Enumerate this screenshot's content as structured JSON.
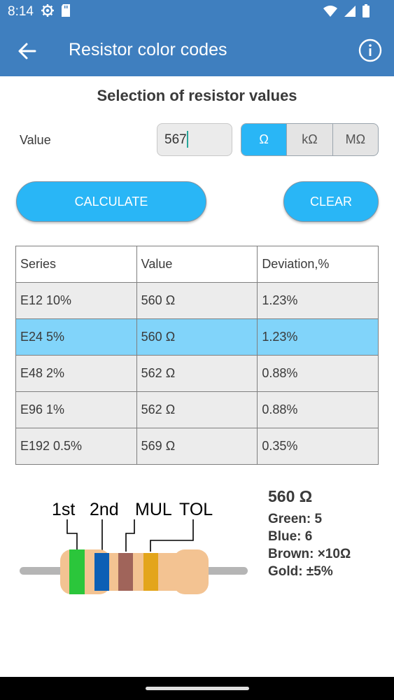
{
  "status": {
    "time": "8:14"
  },
  "appbar": {
    "title": "Resistor color codes"
  },
  "section_title": "Selection of resistor values",
  "input": {
    "label": "Value",
    "value": "567"
  },
  "units": [
    {
      "label": "Ω",
      "active": true
    },
    {
      "label": "kΩ",
      "active": false
    },
    {
      "label": "MΩ",
      "active": false
    }
  ],
  "buttons": {
    "calculate": "CALCULATE",
    "clear": "CLEAR"
  },
  "table": {
    "headers": [
      "Series",
      "Value",
      "Deviation,%"
    ],
    "rows": [
      {
        "series": "E12 10%",
        "value": "560 Ω",
        "deviation": "1.23%",
        "selected": false
      },
      {
        "series": "E24 5%",
        "value": "560 Ω",
        "deviation": "1.23%",
        "selected": true
      },
      {
        "series": "E48 2%",
        "value": "562 Ω",
        "deviation": "0.88%",
        "selected": false
      },
      {
        "series": "E96 1%",
        "value": "562 Ω",
        "deviation": "0.88%",
        "selected": false
      },
      {
        "series": "E192 0.5%",
        "value": "569 Ω",
        "deviation": "0.35%",
        "selected": false
      }
    ]
  },
  "diagram": {
    "labels": {
      "first": "1st",
      "second": "2nd",
      "mul": "MUL",
      "tol": "TOL"
    },
    "band_colors": {
      "first": "#2bc63b",
      "second": "#0c5fb5",
      "mul": "#a0645a",
      "tol": "#e3a51b"
    },
    "body_color": "#f3c392"
  },
  "summary": {
    "value": "560 Ω",
    "bands": [
      "Green: 5",
      "Blue: 6",
      "Brown: ×10Ω",
      "Gold: ±5%"
    ]
  },
  "colors": {
    "appbar": "#3f7fbf",
    "accent": "#29b6f6",
    "selected_row": "#81d4fa"
  }
}
